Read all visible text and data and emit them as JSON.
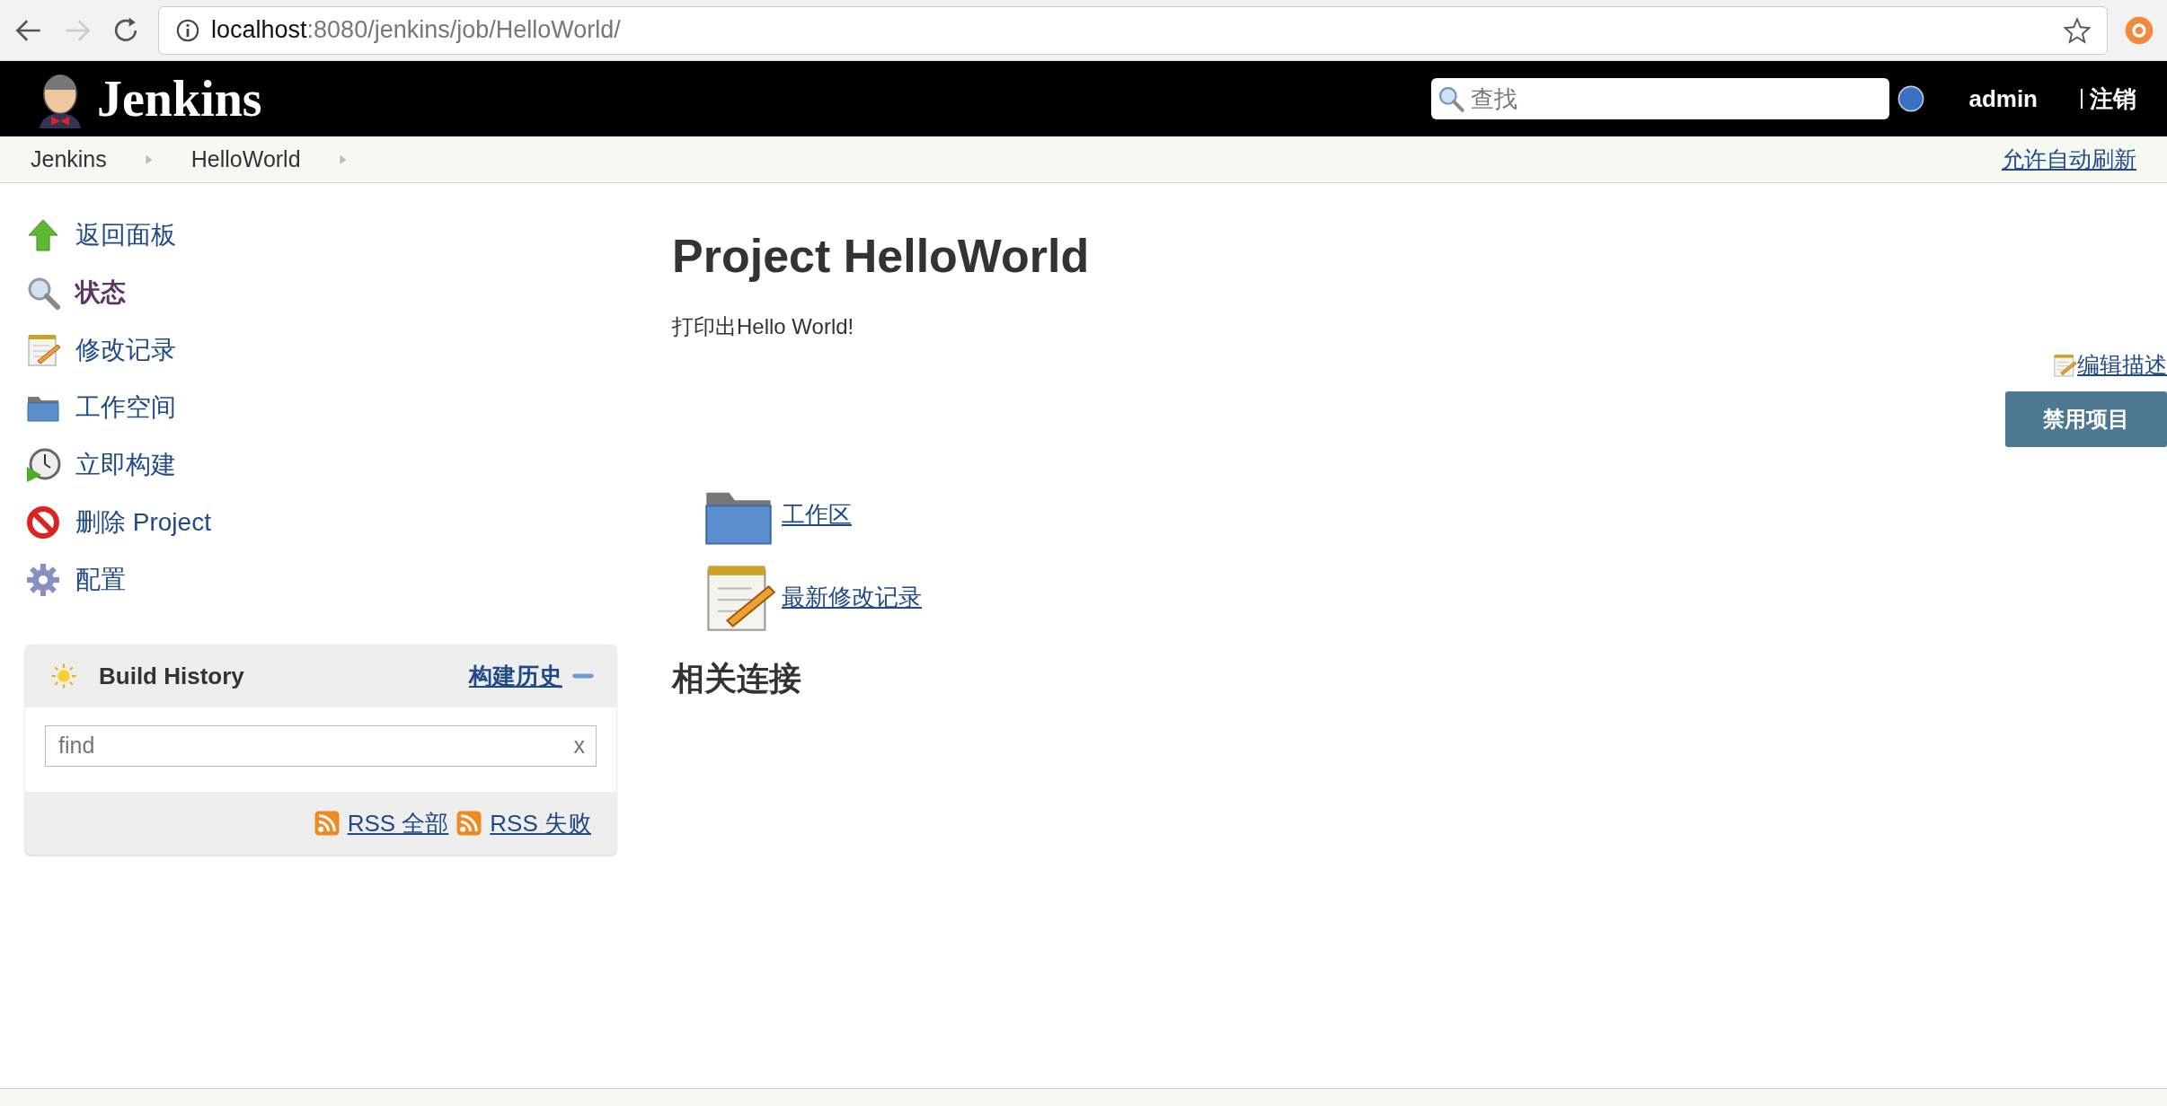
{
  "browser": {
    "url_host": "localhost",
    "url_rest": ":8080/jenkins/job/HelloWorld/",
    "back_enabled": true,
    "forward_enabled": false
  },
  "header": {
    "logo_text": "Jenkins",
    "search": {
      "placeholder": "查找"
    },
    "user": "admin",
    "logout": "注销"
  },
  "breadcrumbs": [
    {
      "label": "Jenkins"
    },
    {
      "label": "HelloWorld"
    }
  ],
  "auto_refresh": "允许自动刷新",
  "sidebar": {
    "items": [
      {
        "label": "返回面板",
        "kind": "up-arrow",
        "selected": false
      },
      {
        "label": "状态",
        "kind": "magnifier",
        "selected": true
      },
      {
        "label": "修改记录",
        "kind": "notepad",
        "selected": false
      },
      {
        "label": "工作空间",
        "kind": "folder",
        "selected": false
      },
      {
        "label": "立即构建",
        "kind": "clock",
        "selected": false
      },
      {
        "label": "删除 Project",
        "kind": "forbidden",
        "selected": false
      },
      {
        "label": "配置",
        "kind": "gear",
        "selected": false
      }
    ]
  },
  "build_history": {
    "title": "Build History",
    "link": "构建历史",
    "search": {
      "placeholder": "find",
      "clear": "x"
    },
    "rss": [
      {
        "label": "RSS 全部"
      },
      {
        "label": "RSS 失败"
      }
    ]
  },
  "main": {
    "title": "Project HelloWorld",
    "description": "打印出Hello World!",
    "edit_description": "编辑描述",
    "disable_button": "禁用项目",
    "links": [
      {
        "label": "工作区",
        "kind": "folder"
      },
      {
        "label": "最新修改记录",
        "kind": "notepad"
      }
    ],
    "section_heading": "相关连接"
  }
}
